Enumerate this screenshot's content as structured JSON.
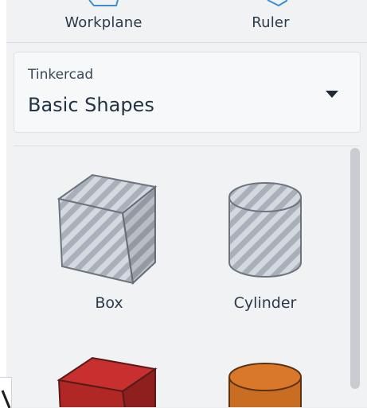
{
  "tools": {
    "workplane_label": "Workplane",
    "ruler_label": "Ruler"
  },
  "library": {
    "category": "Tinkercad",
    "selected": "Basic Shapes"
  },
  "shapes": [
    {
      "label": "Box",
      "icon": "box-hatched-icon"
    },
    {
      "label": "Cylinder",
      "icon": "cylinder-hatched-icon"
    },
    {
      "label": "",
      "icon": "box-red-icon"
    },
    {
      "label": "",
      "icon": "cylinder-orange-icon"
    }
  ],
  "colors": {
    "accent_blue": "#3a8fd6",
    "box_red": "#c8302f",
    "cylinder_orange": "#d9782a"
  }
}
